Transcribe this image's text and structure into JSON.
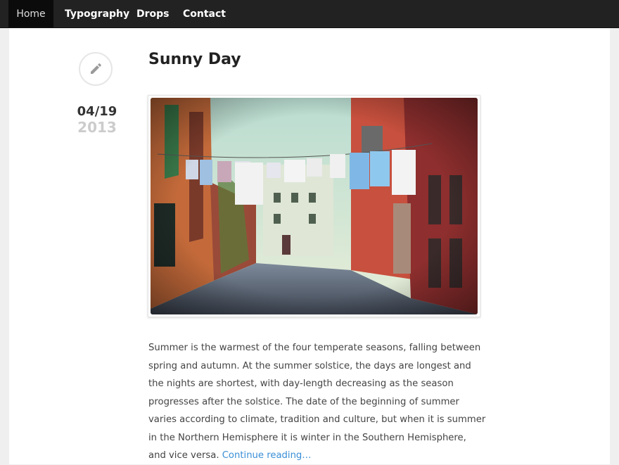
{
  "nav": {
    "items": [
      {
        "label": "Home",
        "active": true
      },
      {
        "label": "Typography",
        "active": false
      },
      {
        "label": "Drops",
        "active": false
      },
      {
        "label": "Contact",
        "active": false
      }
    ]
  },
  "post": {
    "icon": "pencil-icon",
    "date_month_day": "04/19",
    "date_year": "2013",
    "title": "Sunny Day",
    "image_subject": "Narrow Venetian street with laundry hanging between colorful houses",
    "excerpt": "Summer is the warmest of the four temperate seasons, falling between spring and autumn. At the summer solstice, the days are longest and the nights are shortest, with day-length decreasing as the season progresses after the solstice. The date of the beginning of summer varies according to climate, tradition and culture, but when it is summer in the Northern Hemisphere it is winter in the Southern Hemisphere, and vice versa.",
    "continue_label": "Continue reading…"
  },
  "colors": {
    "navbar_bg": "#222222",
    "nav_active_bg": "#0b0b0b",
    "link": "#3a8fd6",
    "title": "#222222",
    "date_year": "#cccccc"
  }
}
